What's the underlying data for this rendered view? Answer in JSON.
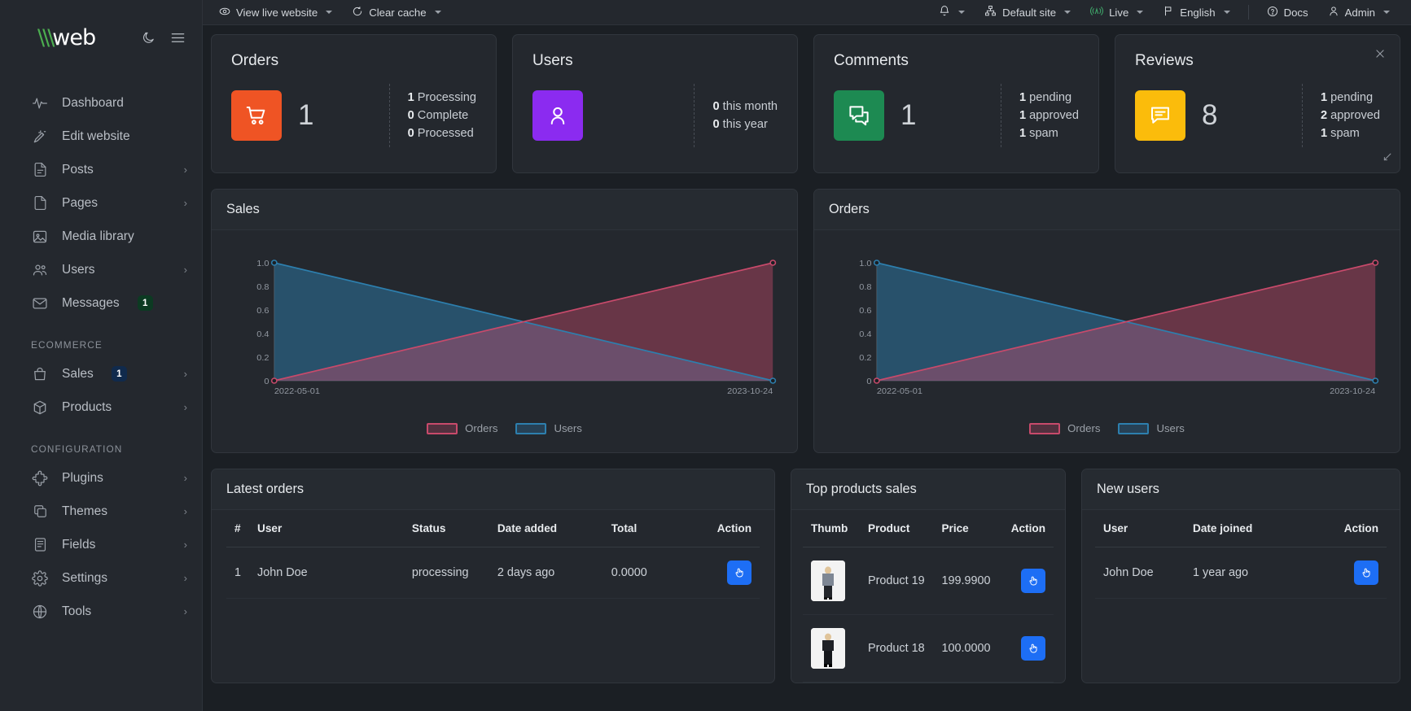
{
  "sidebar": {
    "logo": {
      "part1": "\\\\\\w",
      "part2": "eb"
    },
    "head_icons": [
      {
        "name": "dark-mode-icon"
      },
      {
        "name": "hamburger-menu-icon"
      }
    ],
    "items": [
      {
        "label": "Dashboard",
        "icon": "activity-icon",
        "chevron": false
      },
      {
        "label": "Edit website",
        "icon": "magic-wand-icon",
        "chevron": false
      },
      {
        "label": "Posts",
        "icon": "file-text-icon",
        "chevron": true
      },
      {
        "label": "Pages",
        "icon": "file-icon",
        "chevron": true
      },
      {
        "label": "Media library",
        "icon": "image-icon",
        "chevron": false
      },
      {
        "label": "Users",
        "icon": "users-icon",
        "chevron": true
      },
      {
        "label": "Messages",
        "icon": "mail-icon",
        "chevron": false,
        "badge": "1",
        "badge_color": "green"
      }
    ],
    "groups": [
      {
        "label": "ECOMMERCE",
        "items": [
          {
            "label": "Sales",
            "icon": "bag-icon",
            "chevron": true,
            "badge": "1",
            "badge_color": "blue"
          },
          {
            "label": "Products",
            "icon": "box-icon",
            "chevron": true
          }
        ]
      },
      {
        "label": "CONFIGURATION",
        "items": [
          {
            "label": "Plugins",
            "icon": "puzzle-icon",
            "chevron": true
          },
          {
            "label": "Themes",
            "icon": "layers-icon",
            "chevron": true
          },
          {
            "label": "Fields",
            "icon": "list-doc-icon",
            "chevron": true
          },
          {
            "label": "Settings",
            "icon": "gear-icon",
            "chevron": true
          },
          {
            "label": "Tools",
            "icon": "globe-icon",
            "chevron": true
          }
        ]
      }
    ]
  },
  "topbar": {
    "left": [
      {
        "label": "View live website",
        "icon": "eye-icon",
        "caret": true
      },
      {
        "label": "Clear cache",
        "icon": "refresh-circle-icon",
        "caret": true
      }
    ],
    "right": [
      {
        "label": "",
        "icon": "bell-icon",
        "caret": true
      },
      {
        "label": "Default site",
        "icon": "sitemap-icon",
        "caret": true
      },
      {
        "label": "Live",
        "icon": "broadcast-icon",
        "caret": true,
        "accent": "#3fa76a"
      },
      {
        "label": "English",
        "icon": "flag-icon",
        "caret": true
      },
      {
        "label": "Docs",
        "icon": "help-circle-icon",
        "caret": false
      },
      {
        "label": "Admin",
        "icon": "user-icon",
        "caret": true
      }
    ]
  },
  "stats": [
    {
      "title": "Orders",
      "icon": "shopping-cart-icon",
      "color": "#ef5424",
      "number": "1",
      "lines": [
        {
          "value": "1",
          "label": "Processing"
        },
        {
          "value": "0",
          "label": "Complete"
        },
        {
          "value": "0",
          "label": "Processed"
        }
      ],
      "closable": false
    },
    {
      "title": "Users",
      "icon": "user-avatar-icon",
      "color": "#8b2bf0",
      "number": "",
      "lines": [
        {
          "value": "0",
          "label": "this month"
        },
        {
          "value": "0",
          "label": "this year"
        }
      ],
      "closable": false
    },
    {
      "title": "Comments",
      "icon": "comments-icon",
      "color": "#1d8a52",
      "number": "1",
      "lines": [
        {
          "value": "1",
          "label": "pending"
        },
        {
          "value": "1",
          "label": "approved"
        },
        {
          "value": "1",
          "label": "spam"
        }
      ],
      "closable": false
    },
    {
      "title": "Reviews",
      "icon": "review-bubble-icon",
      "color": "#fbbc0b",
      "number": "8",
      "lines": [
        {
          "value": "1",
          "label": "pending"
        },
        {
          "value": "2",
          "label": "approved"
        },
        {
          "value": "1",
          "label": "spam"
        }
      ],
      "closable": true,
      "resizable": true
    }
  ],
  "chart_data": [
    {
      "type": "area",
      "title": "Sales",
      "x": [
        "2022-05-01",
        "2023-10-24"
      ],
      "xlabel": "",
      "ylabel": "",
      "ylim": [
        0,
        1.0
      ],
      "yticks": [
        "0",
        "0.2",
        "0.4",
        "0.6",
        "0.8",
        "1.0"
      ],
      "grid": false,
      "legend_position": "bottom",
      "series": [
        {
          "name": "Orders",
          "values": [
            0,
            1.0
          ],
          "color": "#c84a6b"
        },
        {
          "name": "Users",
          "values": [
            1.0,
            0
          ],
          "color": "#2d7fae"
        }
      ]
    },
    {
      "type": "area",
      "title": "Orders",
      "x": [
        "2022-05-01",
        "2023-10-24"
      ],
      "xlabel": "",
      "ylabel": "",
      "ylim": [
        0,
        1.0
      ],
      "yticks": [
        "0",
        "0.2",
        "0.4",
        "0.6",
        "0.8",
        "1.0"
      ],
      "grid": false,
      "legend_position": "bottom",
      "series": [
        {
          "name": "Orders",
          "values": [
            0,
            1.0
          ],
          "color": "#c84a6b"
        },
        {
          "name": "Users",
          "values": [
            1.0,
            0
          ],
          "color": "#2d7fae"
        }
      ]
    }
  ],
  "latest_orders": {
    "title": "Latest orders",
    "columns": [
      "#",
      "User",
      "Status",
      "Date added",
      "Total",
      "Action"
    ],
    "rows": [
      {
        "num": "1",
        "user": "John Doe",
        "status": "processing",
        "date": "2 days ago",
        "total": "0.0000",
        "action": "pointer-icon"
      }
    ]
  },
  "top_products": {
    "title": "Top products sales",
    "columns": [
      "Thumb",
      "Product",
      "Price",
      "Action"
    ],
    "rows": [
      {
        "product": "Product 19",
        "price": "199.9900",
        "action": "pointer-icon"
      },
      {
        "product": "Product 18",
        "price": "100.0000",
        "action": "pointer-icon"
      }
    ]
  },
  "new_users": {
    "title": "New users",
    "columns": [
      "User",
      "Date joined",
      "Action"
    ],
    "rows": [
      {
        "user": "John Doe",
        "joined": "1 year ago",
        "action": "pointer-icon"
      }
    ]
  }
}
